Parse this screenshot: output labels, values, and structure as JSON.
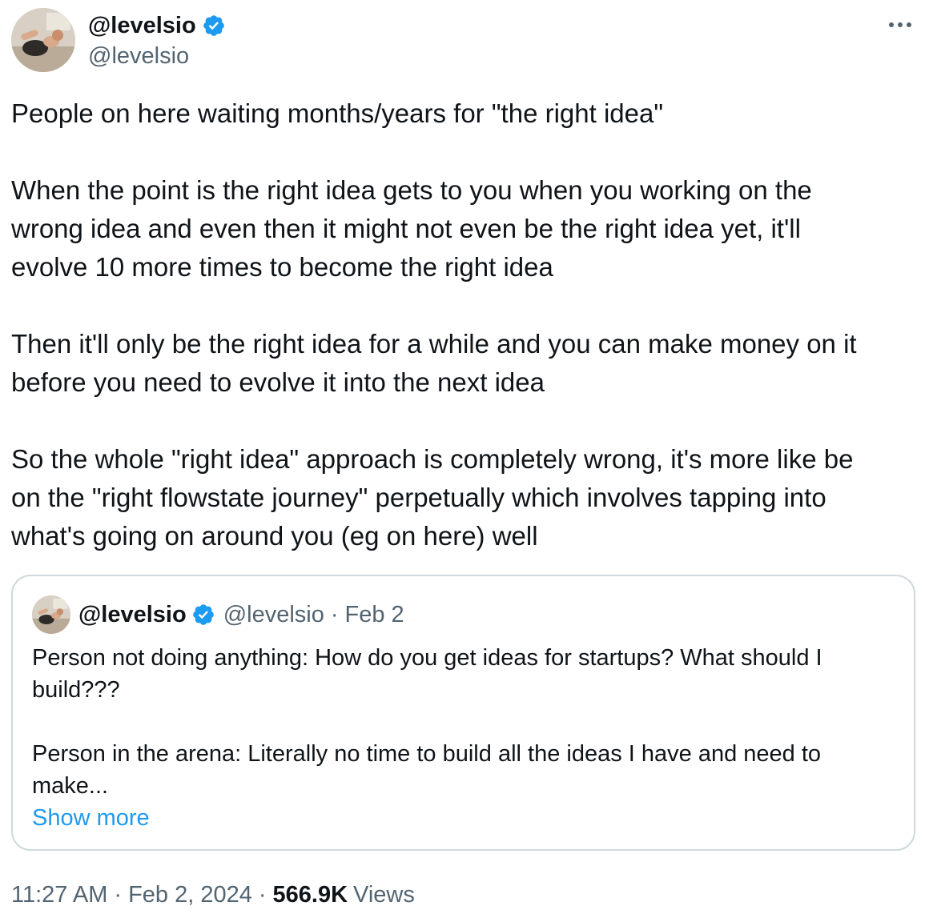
{
  "author": {
    "display_name": "@levelsio",
    "handle": "@levelsio",
    "verified": true
  },
  "tweet": {
    "paragraphs": [
      "People on here waiting months/years for \"the right idea\"",
      "When the point is the right idea gets to you when you working on the\nwrong idea and even then it might not even be the right idea yet, it'll\nevolve 10 more times to become the right idea",
      "Then it'll only be the right idea for a while and you can make money on it\nbefore you need to evolve it into the next idea",
      "So the whole \"right idea\" approach is completely wrong, it's more like be\non the \"right flowstate journey\" perpetually which involves tapping into\nwhat's going on around you (eg on here) well"
    ]
  },
  "quoted_tweet": {
    "display_name": "@levelsio",
    "handle": "@levelsio",
    "separator": "·",
    "date": "Feb 2",
    "paragraphs": [
      "Person not doing anything: How do you get ideas for startups? What should I\nbuild???",
      "Person in the arena: Literally no time to build all the ideas I have and need to\nmake..."
    ],
    "show_more_label": "Show more"
  },
  "meta": {
    "time": "11:27 AM",
    "separator": "·",
    "date": "Feb 2, 2024",
    "views_count": "566.9K",
    "views_label": "Views"
  },
  "colors": {
    "text_primary": "#0f1419",
    "text_secondary": "#536471",
    "link": "#1d9bf0",
    "verified_badge": "#1d9bf0",
    "border": "#cfd9de"
  },
  "icons": {
    "more": "more-horizontal-icon",
    "verified": "verified-badge-icon"
  }
}
